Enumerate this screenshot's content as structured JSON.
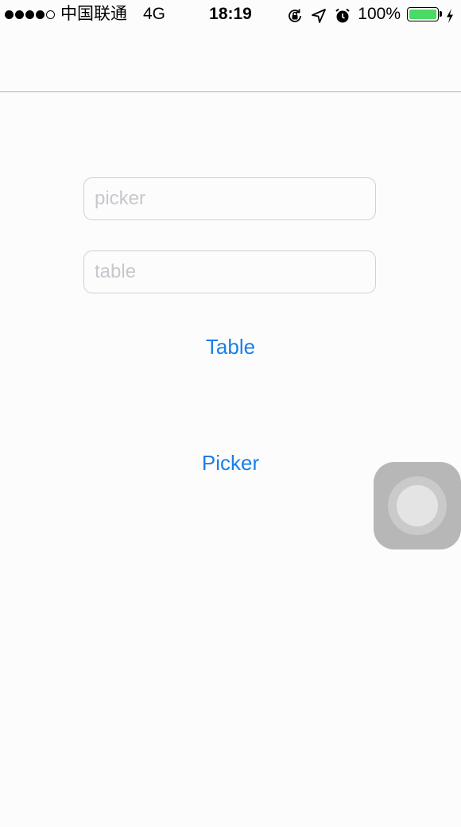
{
  "status_bar": {
    "signal_bars_filled": 4,
    "signal_bars_total": 5,
    "carrier": "中国联通",
    "network": "4G",
    "time": "18:19",
    "icons": [
      "rotation-lock-icon",
      "location-arrow-icon",
      "alarm-icon"
    ],
    "battery_text": "100%",
    "battery_level": 1.0,
    "battery_color": "#4cd964",
    "charging": true
  },
  "fields": {
    "picker": {
      "value": "",
      "placeholder": "picker"
    },
    "table": {
      "value": "",
      "placeholder": "table"
    }
  },
  "buttons": {
    "table_label": "Table",
    "picker_label": "Picker"
  },
  "colors": {
    "accent": "#1a7fe8",
    "background": "#fcfcfc",
    "placeholder": "#c7c7cd"
  }
}
